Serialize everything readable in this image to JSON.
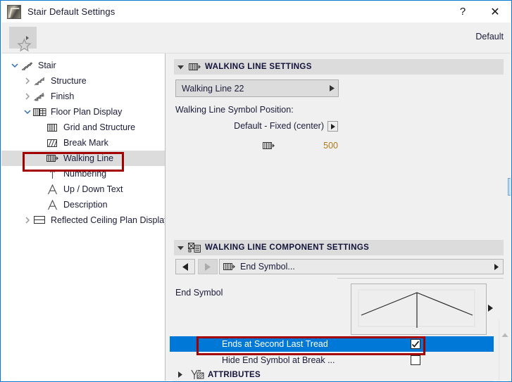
{
  "window": {
    "title": "Stair Default Settings",
    "app_icon": "stair-icon",
    "help_button": "?",
    "close_button": "✕"
  },
  "toolbar": {
    "favorites_icon": "star-icon",
    "favorites_caret": "caret-right-icon",
    "default_label": "Default"
  },
  "tree": {
    "items": [
      {
        "label": "Stair",
        "icon": "stair-icon",
        "depth": 0,
        "twisty": "expanded",
        "selected": false
      },
      {
        "label": "Structure",
        "icon": "structure-icon",
        "depth": 1,
        "twisty": "collapsed",
        "selected": false
      },
      {
        "label": "Finish",
        "icon": "finish-icon",
        "depth": 1,
        "twisty": "collapsed",
        "selected": false
      },
      {
        "label": "Floor Plan Display",
        "icon": "floor-plan-icon",
        "depth": 1,
        "twisty": "expanded",
        "selected": false
      },
      {
        "label": "Grid and Structure",
        "icon": "grid-structure-icon",
        "depth": 2,
        "twisty": "none",
        "selected": false
      },
      {
        "label": "Break Mark",
        "icon": "break-mark-icon",
        "depth": 2,
        "twisty": "none",
        "selected": false
      },
      {
        "label": "Walking Line",
        "icon": "walking-line-icon",
        "depth": 2,
        "twisty": "none",
        "selected": true
      },
      {
        "label": "Numbering",
        "icon": "numbering-icon",
        "depth": 2,
        "twisty": "none",
        "selected": false
      },
      {
        "label": "Up / Down Text",
        "icon": "text-icon",
        "depth": 2,
        "twisty": "none",
        "selected": false
      },
      {
        "label": "Description",
        "icon": "text-icon",
        "depth": 2,
        "twisty": "none",
        "selected": false
      },
      {
        "label": "Reflected Ceiling Plan Display",
        "icon": "rcp-icon",
        "depth": 1,
        "twisty": "collapsed",
        "selected": false
      }
    ]
  },
  "walking_line_settings": {
    "header": "WALKING LINE SETTINGS",
    "header_icon": "walking-line-icon",
    "header_caret": "caret-down-icon",
    "pen_combo_value": "Walking Line 22",
    "symbol_position_label": "Walking Line Symbol Position:",
    "symbol_position_value": "Default - Fixed (center)",
    "offset_icon": "walking-line-icon",
    "offset_value": "500",
    "strip_icons": [
      "walking-line-style-1",
      "walking-line-style-2",
      "walking-line-style-3",
      "walking-line-style-4",
      "walking-line-style-5"
    ],
    "strip_selected_index": 3
  },
  "component_settings": {
    "header": "WALKING LINE COMPONENT SETTINGS",
    "header_icon": "component-icon",
    "header_caret": "caret-down-icon",
    "prev_button": "caret-left-icon",
    "next_button": "caret-right-icon",
    "component_combo_icon": "walking-line-icon",
    "component_combo_value": "End Symbol...",
    "end_symbol_label": "End Symbol",
    "options": [
      {
        "label": "Ends at Second Last Tread",
        "checked": true,
        "selected": true
      },
      {
        "label": "Hide End Symbol at Break ...",
        "checked": false,
        "selected": false
      }
    ],
    "attributes_row": {
      "label": "ATTRIBUTES",
      "icon": "attributes-icon",
      "caret": "caret-right-icon"
    }
  },
  "annotations": {
    "tree_highlight_color": "#a30000",
    "checkbox_highlight_color": "#a30000"
  },
  "colors": {
    "selection_blue": "#0078d7",
    "tree_selection_gray": "#dcdcdc",
    "panel_bg": "#f0f0f0",
    "value_orange": "#b07a18",
    "window_border_blue": "#0a7ad1"
  }
}
